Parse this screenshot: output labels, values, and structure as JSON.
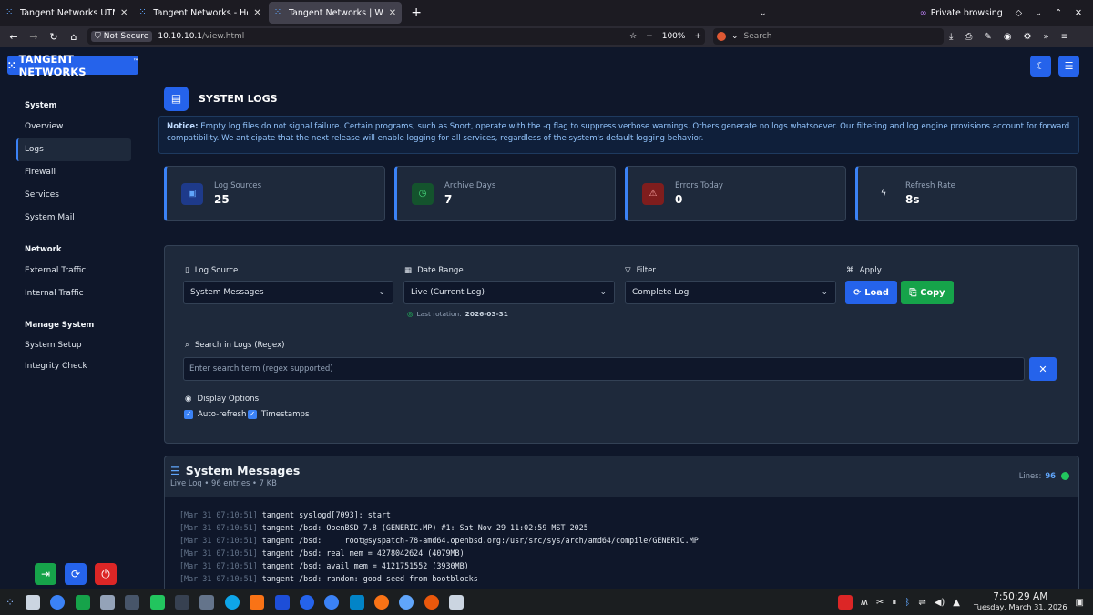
{
  "browser": {
    "tabs": [
      {
        "title": "Tangent Networks UTM —",
        "active": false
      },
      {
        "title": "Tangent Networks - Home",
        "active": false
      },
      {
        "title": "Tangent Networks | Web i",
        "active": true
      }
    ],
    "private_label": "Private browsing",
    "security_label": "Not Secure",
    "url_host": "10.10.10.1",
    "url_path": "/view.html",
    "zoom": "100%",
    "search_placeholder": "Search"
  },
  "app": {
    "brand": "TANGENT NETWORKS",
    "brand_mark": "™",
    "accent": "#2563eb"
  },
  "sidebar": {
    "groups": [
      {
        "label": "System",
        "items": [
          "Overview",
          "Logs",
          "Firewall",
          "Services",
          "System Mail"
        ]
      },
      {
        "label": "Network",
        "items": [
          "External Traffic",
          "Internal Traffic"
        ]
      },
      {
        "label": "Manage System",
        "items": [
          "System Setup",
          "Integrity Check"
        ]
      }
    ],
    "active_item": "Logs"
  },
  "header": {
    "title": "SYSTEM LOGS"
  },
  "notice": {
    "label": "Notice:",
    "text": "Empty log files do not signal failure. Certain programs, such as Snort, operate with the -q flag to suppress verbose warnings. Others generate no logs whatsoever. Our filtering and log engine provisions account for forward compatibility. We anticipate that the next release will enable logging for all services, regardless of the system's default logging behavior."
  },
  "stats": [
    {
      "label": "Log Sources",
      "value": "25",
      "icon": "list-icon",
      "color": "#3b82f6"
    },
    {
      "label": "Archive Days",
      "value": "7",
      "icon": "clock-icon",
      "color": "#22c55e"
    },
    {
      "label": "Errors Today",
      "value": "0",
      "icon": "warning-icon",
      "color": "#ef4444"
    },
    {
      "label": "Refresh Rate",
      "value": "8s",
      "icon": "bolt-icon",
      "color": "#cbd5e1"
    }
  ],
  "controls": {
    "log_source_label": "Log Source",
    "log_source_value": "System Messages",
    "date_range_label": "Date Range",
    "date_range_value": "Live (Current Log)",
    "rotation_label": "Last rotation:",
    "rotation_value": "2026-03-31",
    "filter_label": "Filter",
    "filter_value": "Complete Log",
    "apply_label": "Apply",
    "load_label": "Load",
    "copy_label": "Copy",
    "search_label": "Search in Logs (Regex)",
    "search_placeholder": "Enter search term (regex supported)",
    "display_label": "Display Options",
    "autorefresh_label": "Auto-refresh",
    "timestamps_label": "Timestamps"
  },
  "log": {
    "title": "System Messages",
    "subtitle": "Live Log • 96 entries • 7 KB",
    "lines_label": "Lines:",
    "lines_count": "96",
    "entries": [
      {
        "ts": "[Mar 31 07:10:51]",
        "msg": "tangent syslogd[7093]: start"
      },
      {
        "ts": "[Mar 31 07:10:51]",
        "msg": "tangent /bsd: OpenBSD 7.8 (GENERIC.MP) #1: Sat Nov 29 11:02:59 MST 2025"
      },
      {
        "ts": "[Mar 31 07:10:51]",
        "msg": "tangent /bsd:     root@syspatch-78-amd64.openbsd.org:/usr/src/sys/arch/amd64/compile/GENERIC.MP"
      },
      {
        "ts": "[Mar 31 07:10:51]",
        "msg": "tangent /bsd: real mem = 4278042624 (4079MB)"
      },
      {
        "ts": "[Mar 31 07:10:51]",
        "msg": "tangent /bsd: avail mem = 4121751552 (3930MB)"
      },
      {
        "ts": "[Mar 31 07:10:51]",
        "msg": "tangent /bsd: random: good seed from bootblocks"
      }
    ]
  },
  "taskbar": {
    "time": "7:50:29 AM",
    "date": "Tuesday, March 31, 2026"
  }
}
